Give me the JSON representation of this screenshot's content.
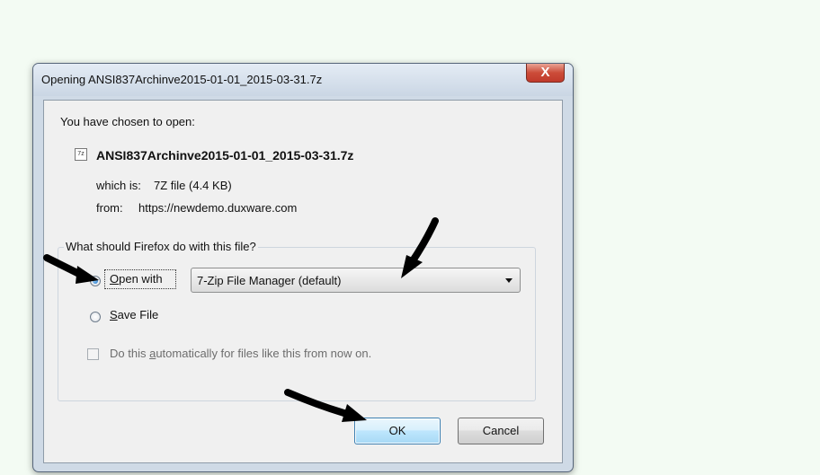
{
  "dialog": {
    "title": "Opening ANSI837Archinve2015-01-01_2015-03-31.7z",
    "close_glyph": "X",
    "chosen_label": "You have chosen to open:",
    "file_icon": "7z-file-icon",
    "file_icon_text": "7z",
    "file_name": "ANSI837Archinve2015-01-01_2015-03-31.7z",
    "which_is_label": "which is:",
    "which_is_value": "7Z file (4.4 KB)",
    "from_label": "from:",
    "from_value": "https://newdemo.duxware.com"
  },
  "action_group": {
    "legend": "What should Firefox do with this file?",
    "open_with": {
      "label_key": "O",
      "label_rest": "pen with",
      "selected": true
    },
    "app_select": {
      "value": "7-Zip File Manager (default)"
    },
    "save_file": {
      "label_key": "S",
      "label_rest": "ave File",
      "selected": false
    },
    "auto_checkbox": {
      "label_pre": "Do this ",
      "label_key": "a",
      "label_rest": "utomatically for files like this from now on.",
      "checked": false,
      "enabled": false
    }
  },
  "buttons": {
    "ok": "OK",
    "cancel": "Cancel"
  },
  "annotations": {
    "arrow_color": "#000000"
  }
}
